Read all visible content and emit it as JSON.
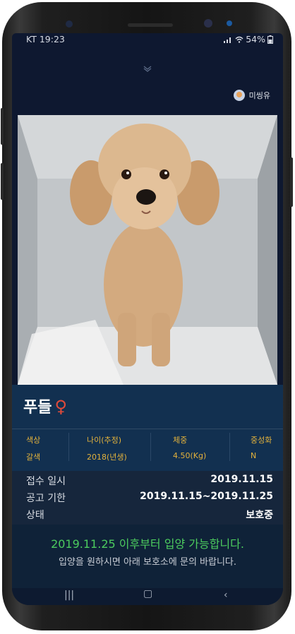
{
  "status_bar": {
    "carrier_time": "KT 19:23",
    "battery": "54%"
  },
  "profile": {
    "name": "미씽유"
  },
  "pet": {
    "breed": "푸들",
    "gender_symbol": "♀",
    "attributes": [
      {
        "label": "색상",
        "value": "갈색"
      },
      {
        "label": "나이(추정)",
        "value": "2018(년생)"
      },
      {
        "label": "체중",
        "value": "4.50(Kg)"
      },
      {
        "label": "중성화",
        "value": "N"
      }
    ],
    "details": [
      {
        "label": "접수 일시",
        "value": "2019.11.15"
      },
      {
        "label": "공고 기한",
        "value": "2019.11.15~2019.11.25"
      },
      {
        "label": "상태",
        "value": "보호중"
      }
    ]
  },
  "notice": {
    "availability": "2019.11.25 이후부터 입양 가능합니다.",
    "contact": "입양을 원하시면 아래 보호소에 문의 바랍니다."
  },
  "colors": {
    "accent_label": "#e3b23c",
    "available_text": "#4ccc5e",
    "gender": "#e04a3a",
    "background": "#0e1830"
  },
  "icons": [
    "wifi-icon",
    "signal-icon",
    "battery-icon",
    "chevron-down-icon",
    "avatar-icon",
    "recent-apps-icon",
    "home-icon",
    "back-icon"
  ]
}
